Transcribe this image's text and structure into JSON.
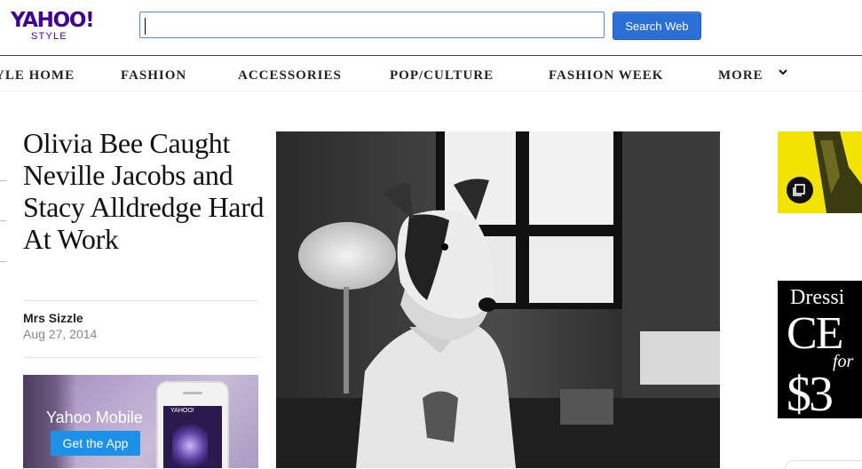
{
  "header": {
    "logo_main": "YAHOO!",
    "logo_sub": "STYLE",
    "search_value": "",
    "search_button": "Search Web"
  },
  "nav": {
    "items": [
      "YLE HOME",
      "FASHION",
      "ACCESSORIES",
      "POP/CULTURE",
      "FASHION WEEK",
      "MORE"
    ]
  },
  "article": {
    "headline": "Olivia Bee Caught Neville Jacobs and Stacy Alldredge Hard At Work",
    "author": "Mrs Sizzle",
    "date": "Aug 27, 2014"
  },
  "ad": {
    "title": "Yahoo Mobile",
    "button": "Get the App",
    "phone_app_title": "YAHOO!"
  },
  "sidebar": {
    "promo_line1": "Dressi",
    "promo_line2": "CE",
    "promo_line3": "for",
    "promo_line4": "$3"
  },
  "colors": {
    "brand": "#400090",
    "search_button": "#2b6fd6",
    "ad_button": "#1e90e8",
    "thumb_yellow": "#f2e300"
  }
}
